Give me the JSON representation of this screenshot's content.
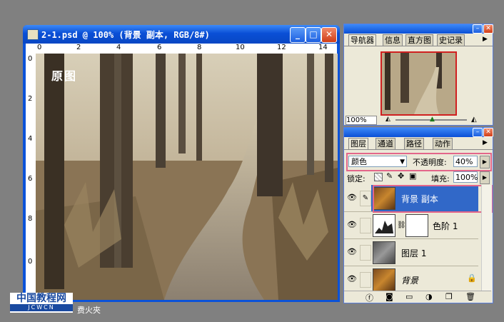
{
  "document": {
    "title": "2-1.psd @ 100% (背景 副本, RGB/8#)",
    "ruler_h_labels": [
      "0",
      "2",
      "4",
      "6",
      "8",
      "10",
      "12",
      "14"
    ],
    "ruler_v_labels": [
      "0",
      "2",
      "4",
      "6",
      "8",
      "0"
    ],
    "canvas_caption": "原图"
  },
  "navigator_panel": {
    "tabs": [
      "导航器",
      "信息",
      "直方图",
      "史记录"
    ],
    "zoom": "100%"
  },
  "layers_panel": {
    "tabs": [
      "图层",
      "通道",
      "路径",
      "动作"
    ],
    "blend_mode": "颜色",
    "opacity_label": "不透明度:",
    "opacity_value": "40%",
    "lock_label": "锁定:",
    "fill_label": "填充:",
    "fill_value": "100%",
    "layers": [
      {
        "name": "背景 副本",
        "selected": true
      },
      {
        "name": "色阶 1",
        "selected": false
      },
      {
        "name": "图层 1",
        "selected": false
      },
      {
        "name": "背景",
        "selected": false
      }
    ]
  },
  "watermark": {
    "text": "中国教程网",
    "sub": "JCWCN",
    "right": "费火夾"
  },
  "colors": {
    "accent": "#0b52d8",
    "selection": "#3168c8",
    "highlight": "#e3668a"
  }
}
